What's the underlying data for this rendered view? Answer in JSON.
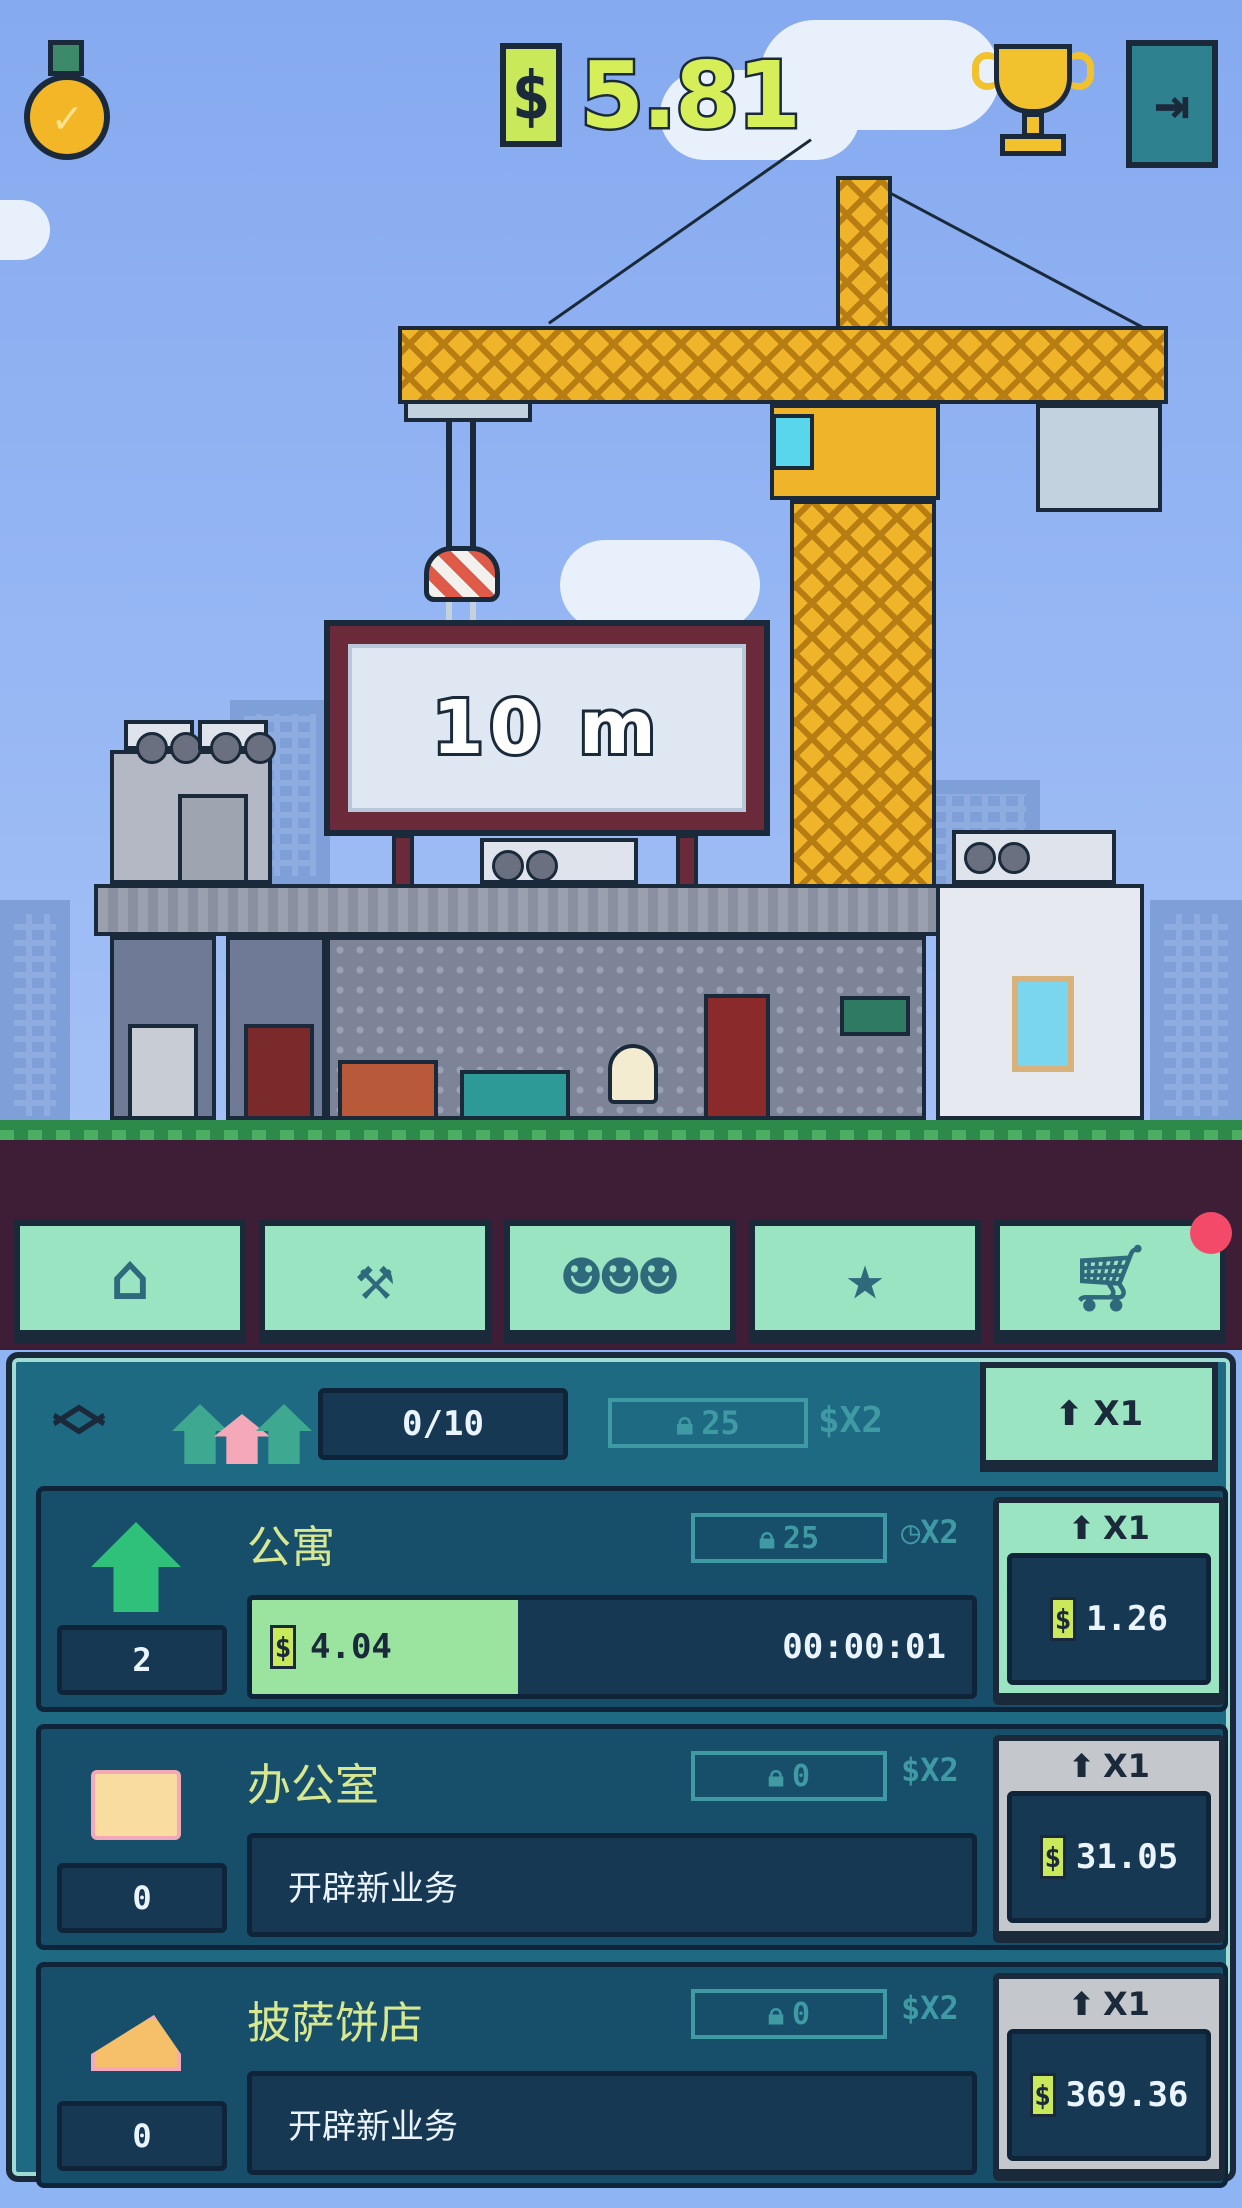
{
  "top_bar": {
    "currency_symbol": "$",
    "balance": "5.81",
    "medal_icon": "medal-icon",
    "trophy_icon": "trophy-icon",
    "exit_icon": "exit-icon"
  },
  "sign": {
    "height_text": "10 m"
  },
  "tabs": [
    {
      "id": "build",
      "icon": "house-icon"
    },
    {
      "id": "upgrades",
      "icon": "wrench-icon"
    },
    {
      "id": "managers",
      "icon": "people-icon"
    },
    {
      "id": "stars",
      "icon": "star-icon"
    },
    {
      "id": "shop",
      "icon": "cart-icon"
    }
  ],
  "panel": {
    "capacity": "0/10",
    "lock_value": "25",
    "multiplier_locked": "$X2",
    "buy_multiplier": "X1"
  },
  "businesses": [
    {
      "name": "公寓",
      "count": "2",
      "lock_value": "25",
      "speed_multiplier": "X2",
      "progress_value": "4.04",
      "progress_fraction": 0.37,
      "timer": "00:00:01",
      "buy_multiplier": "X1",
      "price": "1.26",
      "state": "active",
      "icon": "house-icon"
    },
    {
      "name": "办公室",
      "count": "0",
      "lock_value": "0",
      "multiplier": "$X2",
      "new_business_label": "开辟新业务",
      "buy_multiplier": "X1",
      "price": "31.05",
      "state": "inactive",
      "icon": "folder-icon"
    },
    {
      "name": "披萨饼店",
      "count": "0",
      "lock_value": "0",
      "multiplier": "$X2",
      "new_business_label": "开辟新业务",
      "buy_multiplier": "X1",
      "price": "369.36",
      "state": "inactive",
      "icon": "pizza-icon"
    }
  ],
  "colors": {
    "sky": "#8fb4f4",
    "crane_yellow": "#f0b42a",
    "panel_teal": "#1e6a82",
    "mint": "#9be4c2",
    "accent_green": "#c9e85a",
    "notification": "#f44a6a"
  }
}
